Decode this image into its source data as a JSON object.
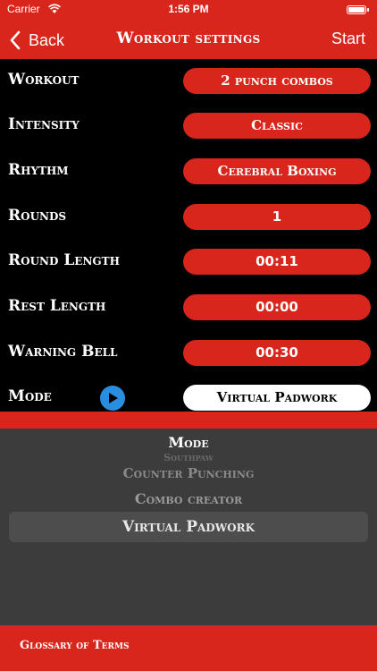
{
  "status_bar": {
    "carrier": "Carrier",
    "time": "1:56 PM"
  },
  "nav": {
    "back_label": "Back",
    "title": "Workout settings",
    "start_label": "Start"
  },
  "settings": {
    "workout": {
      "label": "Workout",
      "value": "2 punch combos"
    },
    "intensity": {
      "label": "Intensity",
      "value": "Classic"
    },
    "rhythm": {
      "label": "Rhythm",
      "value": "Cerebral Boxing"
    },
    "rounds": {
      "label": "Rounds",
      "value": "1"
    },
    "round_length": {
      "label": "Round Length",
      "value": "00:11"
    },
    "rest_length": {
      "label": "Rest Length",
      "value": "00:00"
    },
    "warning_bell": {
      "label": "Warning Bell",
      "value": "00:30"
    },
    "mode": {
      "label": "Mode",
      "value": "Virtual Padwork"
    }
  },
  "picker": {
    "title": "Mode",
    "options": [
      "Southpaw",
      "Counter Punching",
      "Combo creator"
    ],
    "selected": "Virtual Padwork"
  },
  "footer": {
    "glossary_label": "Glossary of Terms"
  },
  "colors": {
    "accent": "#d9261c",
    "background": "#000000",
    "picker_bg": "#3c3c3c",
    "info_blue": "#2a8ee0"
  }
}
